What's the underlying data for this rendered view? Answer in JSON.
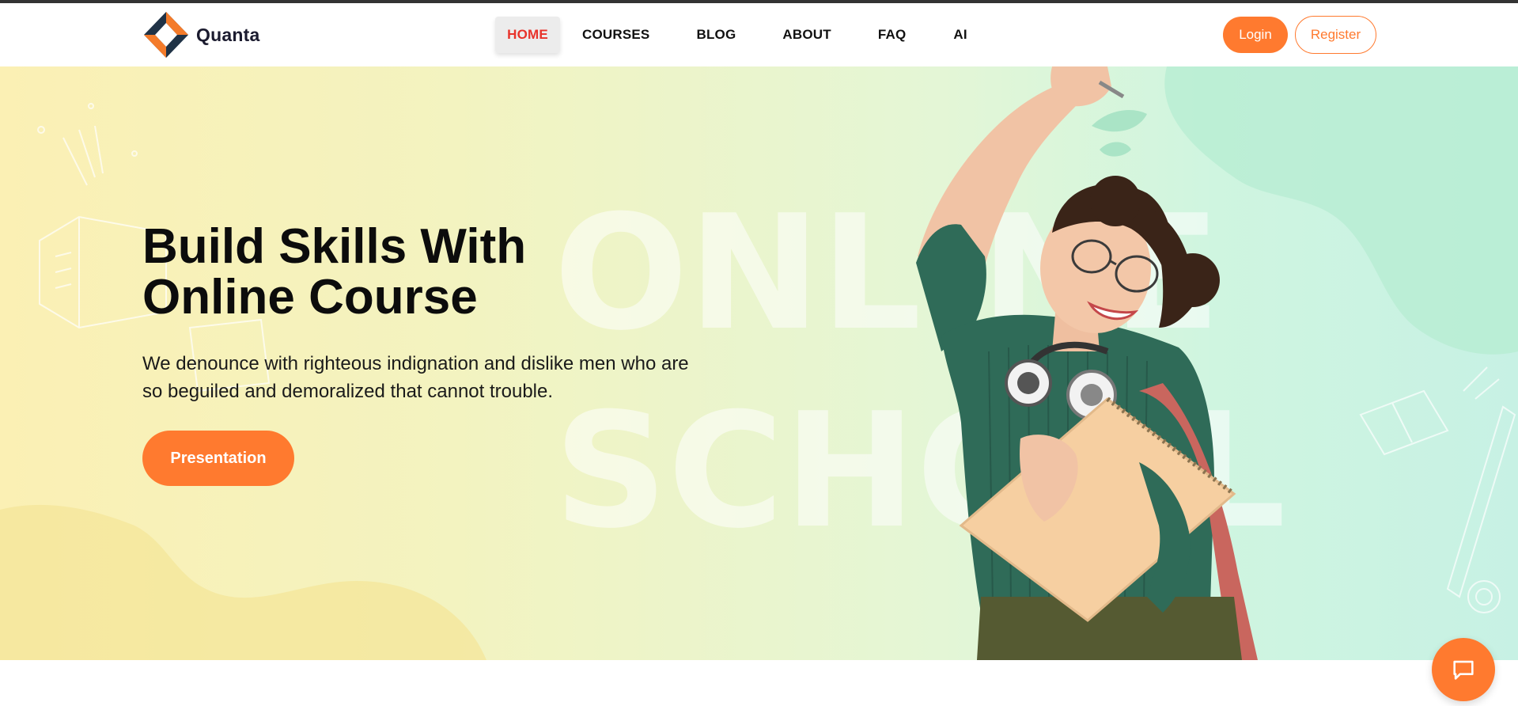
{
  "brand": {
    "name": "Quanta",
    "logo_icon": "diamond-logo-icon"
  },
  "nav": {
    "items": [
      {
        "label": "HOME",
        "active": true
      },
      {
        "label": "COURSES",
        "active": false
      },
      {
        "label": "BLOG",
        "active": false
      },
      {
        "label": "ABOUT",
        "active": false
      },
      {
        "label": "FAQ",
        "active": false
      },
      {
        "label": "AI",
        "active": false
      }
    ]
  },
  "auth": {
    "login_label": "Login",
    "register_label": "Register"
  },
  "hero": {
    "title_line1": "Build Skills With",
    "title_line2": "Online Course",
    "description": "We denounce with righteous indignation and dislike men who are so beguiled and demoralized that cannot trouble.",
    "cta_label": "Presentation",
    "background_word_1": "ONLINE",
    "background_word_2": "SCHOOL",
    "image": "student-girl-with-notebook"
  },
  "chat": {
    "icon": "chat-bubble-icon"
  },
  "colors": {
    "accent": "#ff7a2f",
    "active_nav": "#e8332b",
    "logo_dark": "#1f3246",
    "logo_orange": "#f47b2a"
  }
}
